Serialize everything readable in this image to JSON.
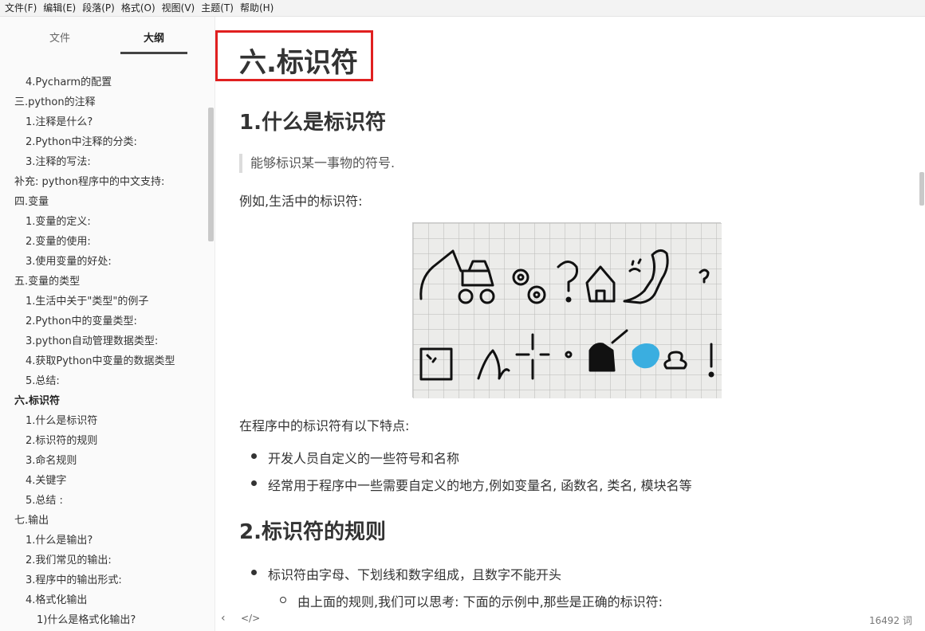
{
  "menubar": {
    "items": [
      "文件(F)",
      "编辑(E)",
      "段落(P)",
      "格式(O)",
      "视图(V)",
      "主题(T)",
      "帮助(H)"
    ]
  },
  "sidebar": {
    "tabs": [
      "文件",
      "大纲"
    ],
    "active_tab": "大纲",
    "outline": [
      {
        "label": "4.Pycharm的配置",
        "level": 1
      },
      {
        "label": "三.python的注释",
        "level": 0
      },
      {
        "label": "1.注释是什么?",
        "level": 1
      },
      {
        "label": "2.Python中注释的分类:",
        "level": 1
      },
      {
        "label": "3.注释的写法:",
        "level": 1
      },
      {
        "label": "补充: python程序中的中文支持:",
        "level": 0
      },
      {
        "label": "四.变量",
        "level": 0
      },
      {
        "label": "1.变量的定义:",
        "level": 1
      },
      {
        "label": "2.变量的使用:",
        "level": 1
      },
      {
        "label": "3.使用变量的好处:",
        "level": 1
      },
      {
        "label": "五.变量的类型",
        "level": 0
      },
      {
        "label": "1.生活中关于\"类型\"的例子",
        "level": 1
      },
      {
        "label": "2.Python中的变量类型:",
        "level": 1
      },
      {
        "label": "3.python自动管理数据类型:",
        "level": 1
      },
      {
        "label": "4.获取Python中变量的数据类型",
        "level": 1
      },
      {
        "label": "5.总结:",
        "level": 1
      },
      {
        "label": "六.标识符",
        "level": 0,
        "active": true
      },
      {
        "label": "1.什么是标识符",
        "level": 1
      },
      {
        "label": "2.标识符的规则",
        "level": 1
      },
      {
        "label": "3.命名规则",
        "level": 1
      },
      {
        "label": "4.关键字",
        "level": 1
      },
      {
        "label": "5.总结 :",
        "level": 1
      },
      {
        "label": "七.输出",
        "level": 0
      },
      {
        "label": "1.什么是输出?",
        "level": 1
      },
      {
        "label": "2.我们常见的输出:",
        "level": 1
      },
      {
        "label": "3.程序中的输出形式:",
        "level": 1
      },
      {
        "label": "4.格式化输出",
        "level": 1
      },
      {
        "label": "1)什么是格式化输出?",
        "level": 2
      }
    ]
  },
  "editor": {
    "h1": "六.标识符",
    "section1_title": "1.什么是标识符",
    "quote": "能够标识某一事物的符号.",
    "example_text": "例如,生活中的标识符:",
    "features_intro": "在程序中的标识符有以下特点:",
    "features": [
      "开发人员自定义的一些符号和名称",
      "经常用于程序中一些需要自定义的地方,例如变量名, 函数名, 类名, 模块名等"
    ],
    "section2_title": "2.标识符的规则",
    "rule1": "标识符由字母、下划线和数字组成，且数字不能开头",
    "rule1_sub": "由上面的规则,我们可以思考: 下面的示例中,那些是正确的标识符:"
  },
  "statusbar": {
    "word_count": "16492 词"
  }
}
